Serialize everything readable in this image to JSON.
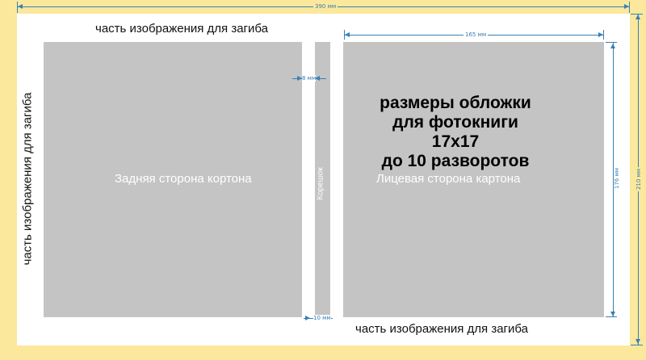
{
  "dimensions": {
    "total_width": "390 мм",
    "total_height": "210 мм",
    "front_width": "165 мм",
    "front_height": "176 мм",
    "spine_gap_top": "8 мм",
    "spine_gap_bottom": "10 мм"
  },
  "labels": {
    "fold_top": "часть изображения для загиба",
    "fold_bottom": "часть изображения для загиба",
    "fold_left": "часть изображения для загиба",
    "back_side": "Задняя сторона кортона",
    "front_side": "Лицевая сторона картона",
    "spine": "Корешок"
  },
  "headline": {
    "line1": "размеры обложки",
    "line2": "для фотокниги",
    "line3": "17х17",
    "line4": "до 10 разворотов"
  },
  "colors": {
    "background": "#fbe89c",
    "sheet": "#ffffff",
    "panel": "#c4c4c4",
    "dimension": "#3a7fb4"
  }
}
